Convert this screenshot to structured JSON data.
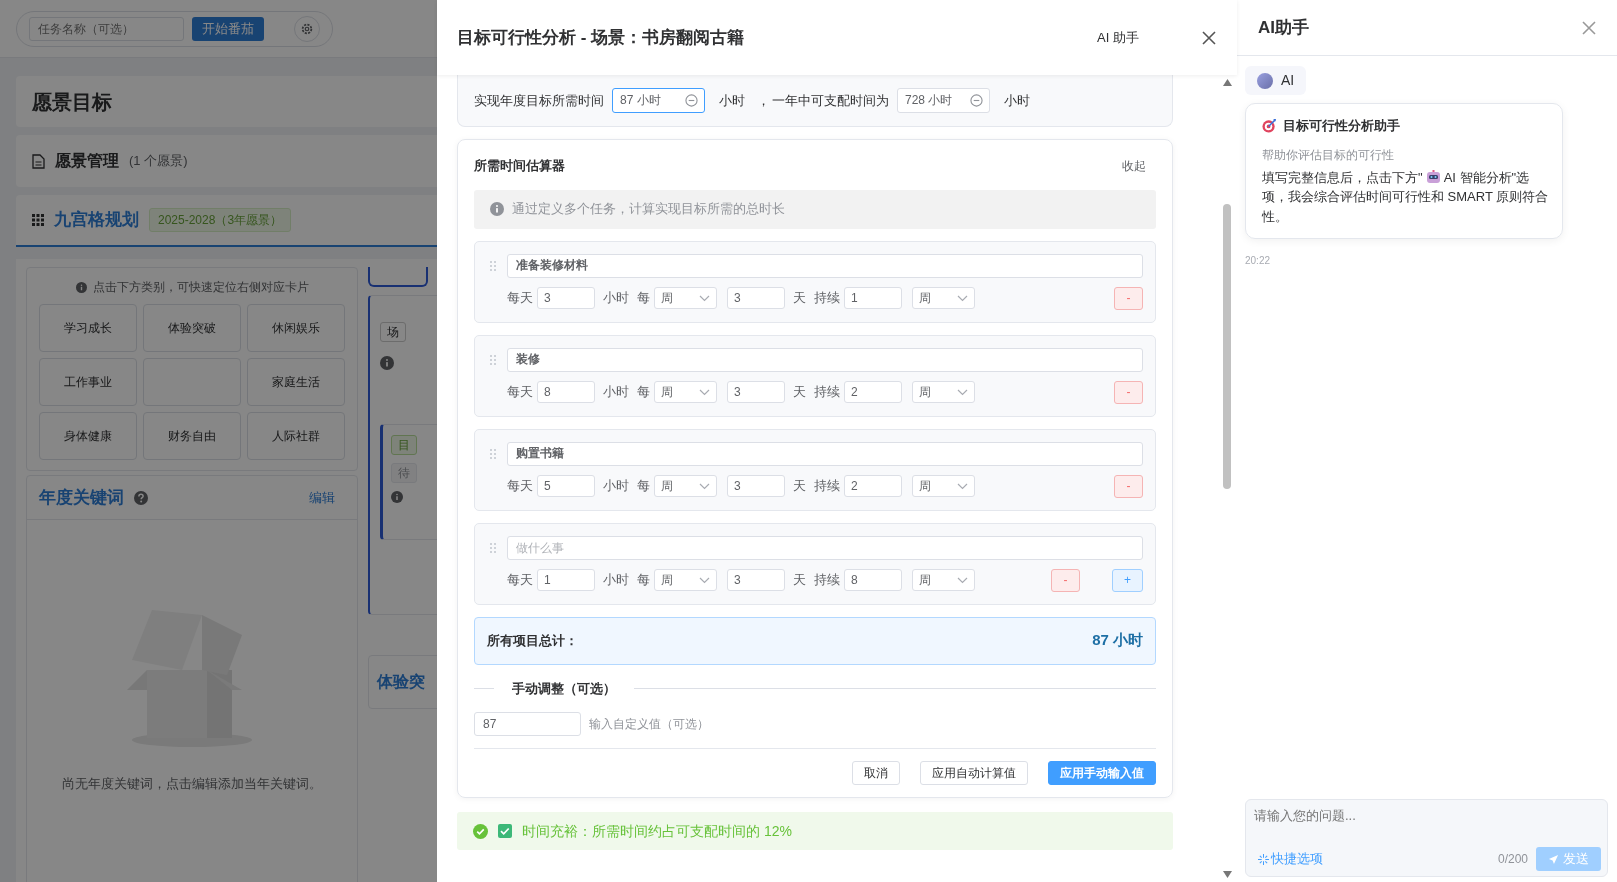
{
  "background": {
    "toolbar": {
      "task_placeholder": "任务名称（可选）",
      "start_button": "开始番茄"
    },
    "page_title": "愿景目标",
    "vision_card": {
      "title": "愿景管理",
      "count": "(1 个愿景)"
    },
    "grid_card": {
      "title": "九宫格规划",
      "badge": "2025-2028（3年愿景）"
    },
    "category_hint": "点击下方类别，可快速定位右侧对应卡片",
    "categories": [
      {
        "kind": "category",
        "label": "学习成长"
      },
      {
        "kind": "category",
        "label": "体验突破"
      },
      {
        "kind": "category",
        "label": "休闲娱乐"
      },
      {
        "kind": "category",
        "label": "工作事业"
      },
      {
        "kind": "blank"
      },
      {
        "kind": "category",
        "label": "家庭生活"
      },
      {
        "kind": "category",
        "label": "身体健康"
      },
      {
        "kind": "category",
        "label": "财务自由"
      },
      {
        "kind": "category",
        "label": "人际社群"
      }
    ],
    "keywords_card": {
      "title": "年度关键词",
      "edit_link": "编辑",
      "empty_text": "尚无年度关键词，点击编辑添加当年关键词。"
    },
    "side_fragments": {
      "scene_tag": "场",
      "goal_tag": "目",
      "pending_tag": "待",
      "section_title": "体验突"
    }
  },
  "modal": {
    "title": "目标可行性分析 - 场景：书房翻阅古籍",
    "ai_link": "AI 助手",
    "time_row": {
      "label": "实现年度目标所需时间",
      "required": "87 小时",
      "unit_1": "小时",
      "separator": "，",
      "middle": "一年中可支配时间为",
      "available": "728 小时",
      "unit_2": "小时"
    },
    "estimator": {
      "title": "所需时间估算器",
      "collapse": "收起",
      "info": "通过定义多个任务，计算实现目标所需的总时长",
      "tasks": [
        {
          "name": "准备装修材料",
          "labels": [
            "每天",
            "小时",
            "每",
            "天",
            "持续"
          ],
          "hours": "3",
          "period": "周",
          "days": "3",
          "duration": "1",
          "duration_unit": "周",
          "buttons": [
            {
              "kind": "remove",
              "label": "-"
            }
          ]
        },
        {
          "name": "装修",
          "labels": [
            "每天",
            "小时",
            "每",
            "天",
            "持续"
          ],
          "hours": "8",
          "period": "周",
          "days": "3",
          "duration": "2",
          "duration_unit": "周",
          "buttons": [
            {
              "kind": "remove",
              "label": "-"
            }
          ]
        },
        {
          "name": "购置书籍",
          "labels": [
            "每天",
            "小时",
            "每",
            "天",
            "持续"
          ],
          "hours": "5",
          "period": "周",
          "days": "3",
          "duration": "2",
          "duration_unit": "周",
          "buttons": [
            {
              "kind": "remove",
              "label": "-"
            }
          ]
        },
        {
          "placeholder": "做什么事",
          "labels": [
            "每天",
            "小时",
            "每",
            "天",
            "持续"
          ],
          "hours": "1",
          "period": "周",
          "days": "3",
          "duration": "8",
          "duration_unit": "周",
          "buttons": [
            {
              "kind": "remove",
              "label": "-"
            },
            {
              "kind": "add",
              "label": "+"
            }
          ]
        }
      ],
      "total": {
        "label": "所有项目总计：",
        "value": "87 小时"
      },
      "manual": {
        "title": "手动调整（可选）",
        "value": "87",
        "hint": "输入自定义值（可选）"
      },
      "actions": [
        {
          "label": "取消",
          "primary": false
        },
        {
          "label": "应用自动计算值",
          "primary": false
        },
        {
          "label": "应用手动输入值",
          "primary": true
        }
      ]
    },
    "status": {
      "text": "时间充裕：所需时间约占可支配时间的 12%"
    }
  },
  "assistant": {
    "title": "AI助手",
    "sender": "AI",
    "message": {
      "title": "目标可行性分析助手",
      "subtitle": "帮助你评估目标的可行性",
      "body_before": "填写完整信息后，点击下方\"",
      "body_after": "AI 智能分析\"选",
      "body_line_2": "项，我会综合评估时间可行性和 SMART 原则符合",
      "body_line_3": "性。"
    },
    "time": "20:22",
    "input": {
      "placeholder": "请输入您的问题..."
    },
    "quick_options": "快捷选项",
    "counter": "0/200",
    "send": {
      "label": "发送",
      "disabled": true
    }
  }
}
